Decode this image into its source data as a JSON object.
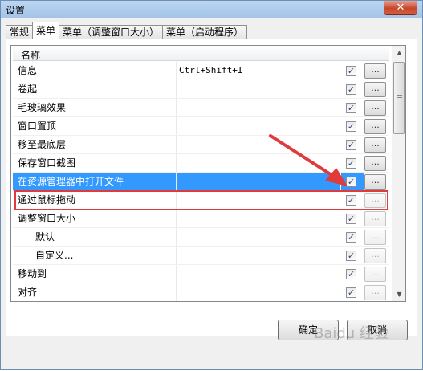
{
  "window": {
    "title": "设置",
    "close_label": "✕"
  },
  "tabs": [
    {
      "label": "常规"
    },
    {
      "label": "菜单"
    },
    {
      "label": "菜单（调整窗口大小）"
    },
    {
      "label": "菜单（启动程序）"
    }
  ],
  "active_tab": 1,
  "list": {
    "column_header": "名称",
    "button_label": "...",
    "rows": [
      {
        "name": "信息",
        "shortcut": "Ctrl+Shift+I",
        "checked": true,
        "indent": false,
        "selected": false,
        "button_enabled": true
      },
      {
        "name": "卷起",
        "shortcut": "",
        "checked": true,
        "indent": false,
        "selected": false,
        "button_enabled": true
      },
      {
        "name": "毛玻璃效果",
        "shortcut": "",
        "checked": true,
        "indent": false,
        "selected": false,
        "button_enabled": true
      },
      {
        "name": "窗口置顶",
        "shortcut": "",
        "checked": true,
        "indent": false,
        "selected": false,
        "button_enabled": true
      },
      {
        "name": "移至最底层",
        "shortcut": "",
        "checked": true,
        "indent": false,
        "selected": false,
        "button_enabled": true
      },
      {
        "name": "保存窗口截图",
        "shortcut": "",
        "checked": true,
        "indent": false,
        "selected": false,
        "button_enabled": true
      },
      {
        "name": "在资源管理器中打开文件",
        "shortcut": "",
        "checked": true,
        "indent": false,
        "selected": true,
        "button_enabled": true
      },
      {
        "name": "通过鼠标拖动",
        "shortcut": "",
        "checked": true,
        "indent": false,
        "selected": false,
        "button_enabled": false
      },
      {
        "name": "调整窗口大小",
        "shortcut": "",
        "checked": true,
        "indent": false,
        "selected": false,
        "button_enabled": false
      },
      {
        "name": "默认",
        "shortcut": "",
        "checked": true,
        "indent": true,
        "selected": false,
        "button_enabled": false
      },
      {
        "name": "自定义...",
        "shortcut": "",
        "checked": true,
        "indent": true,
        "selected": false,
        "button_enabled": false
      },
      {
        "name": "移动到",
        "shortcut": "",
        "checked": true,
        "indent": false,
        "selected": false,
        "button_enabled": false
      },
      {
        "name": "对齐",
        "shortcut": "",
        "checked": true,
        "indent": false,
        "selected": false,
        "button_enabled": false
      }
    ]
  },
  "buttons": {
    "ok": "确定",
    "cancel": "取消"
  },
  "watermark": "Baidu 经验",
  "colors": {
    "selection": "#3399ff",
    "highlight_outline": "#e03a3a",
    "annotation_arrow": "#e03a3a"
  }
}
